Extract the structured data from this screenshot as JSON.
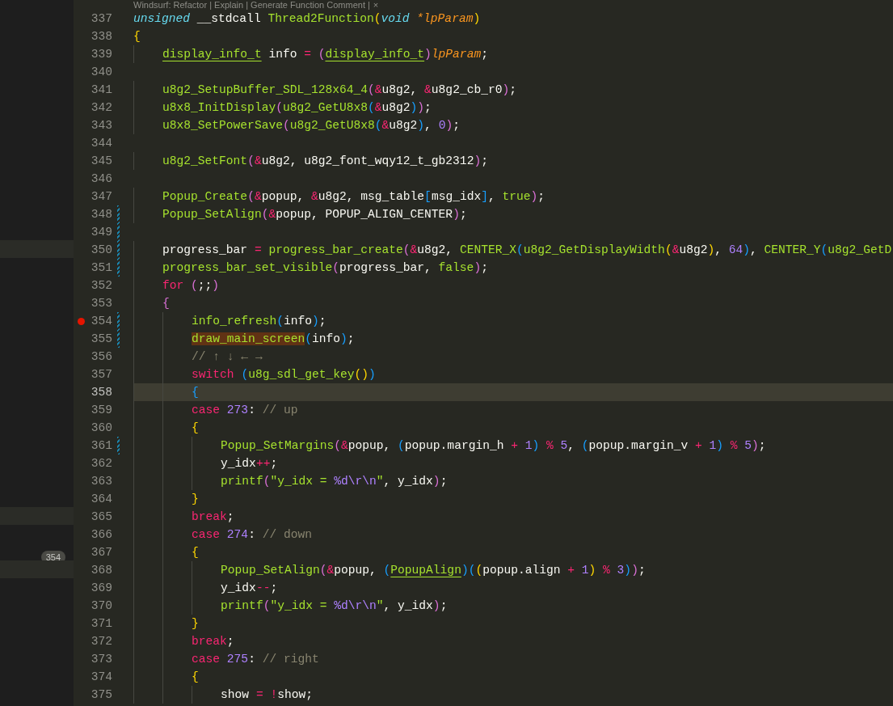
{
  "codelens": {
    "text": "Windsurf: Refactor | Explain | Generate Function Comment |",
    "close": "×"
  },
  "side_panel": {
    "rows": [
      {
        "kind": "blank"
      },
      {
        "kind": "blank"
      },
      {
        "kind": "blank"
      },
      {
        "kind": "blank"
      },
      {
        "kind": "blank"
      },
      {
        "kind": "blank"
      },
      {
        "kind": "blank"
      },
      {
        "kind": "blank"
      },
      {
        "kind": "blank"
      },
      {
        "kind": "blank"
      },
      {
        "kind": "blank"
      },
      {
        "kind": "blank"
      },
      {
        "kind": "blank"
      },
      {
        "kind": "band"
      },
      {
        "kind": "blank"
      },
      {
        "kind": "blank"
      },
      {
        "kind": "blank"
      },
      {
        "kind": "blank"
      },
      {
        "kind": "blank"
      },
      {
        "kind": "blank"
      },
      {
        "kind": "blank"
      },
      {
        "kind": "blank"
      },
      {
        "kind": "blank"
      },
      {
        "kind": "blank"
      },
      {
        "kind": "blank"
      },
      {
        "kind": "blank"
      },
      {
        "kind": "blank"
      },
      {
        "kind": "blank"
      },
      {
        "kind": "band"
      },
      {
        "kind": "blank"
      },
      {
        "kind": "blank",
        "badge": "354"
      },
      {
        "kind": "band"
      },
      {
        "kind": "blank"
      },
      {
        "kind": "blank"
      },
      {
        "kind": "blank"
      },
      {
        "kind": "blank"
      },
      {
        "kind": "blank"
      },
      {
        "kind": "blank"
      },
      {
        "kind": "blank"
      }
    ]
  },
  "lines": [
    {
      "number": "337",
      "current": false,
      "breakpoint": false,
      "modified": false,
      "tokens": [
        {
          "kind": "type",
          "text": "unsigned"
        },
        {
          "kind": "plain",
          "text": " __stdcall "
        },
        {
          "kind": "fn",
          "text": "Thread2Function"
        },
        {
          "kind": "bracket1",
          "text": "("
        },
        {
          "kind": "type",
          "text": "void "
        },
        {
          "kind": "param",
          "text": "*lpParam"
        },
        {
          "kind": "bracket1",
          "text": ")"
        }
      ]
    },
    {
      "number": "338",
      "current": false,
      "breakpoint": false,
      "modified": false,
      "tokens": [
        {
          "kind": "bracket1",
          "text": "{"
        }
      ]
    },
    {
      "number": "339",
      "current": false,
      "breakpoint": false,
      "modified": false,
      "tokens": [
        {
          "kind": "typeref",
          "text": "    display_info_t"
        },
        {
          "kind": "plain",
          "text": " info "
        },
        {
          "kind": "op",
          "text": "= "
        },
        {
          "kind": "bracket2",
          "text": "("
        },
        {
          "kind": "typeref",
          "text": "display_info_t"
        },
        {
          "kind": "bracket2",
          "text": ")"
        },
        {
          "kind": "param",
          "text": "lpParam"
        },
        {
          "kind": "plain",
          "text": ";"
        }
      ]
    },
    {
      "number": "340",
      "current": false,
      "breakpoint": false,
      "modified": false
    },
    {
      "number": "341",
      "current": false,
      "breakpoint": false,
      "modified": false,
      "tokens": [
        {
          "kind": "fn",
          "text": "    u8g2_SetupBuffer_SDL_128x64_4"
        },
        {
          "kind": "bracket2",
          "text": "("
        },
        {
          "kind": "op",
          "text": "&"
        },
        {
          "kind": "plain",
          "text": "u8g2, "
        },
        {
          "kind": "op",
          "text": "&"
        },
        {
          "kind": "plain",
          "text": "u8g2_cb_r0"
        },
        {
          "kind": "bracket2",
          "text": ")"
        },
        {
          "kind": "plain",
          "text": ";"
        }
      ]
    },
    {
      "number": "342",
      "current": false,
      "breakpoint": false,
      "modified": false,
      "tokens": [
        {
          "kind": "fn",
          "text": "    u8x8_InitDisplay"
        },
        {
          "kind": "bracket2",
          "text": "("
        },
        {
          "kind": "fn",
          "text": "u8g2_GetU8x8"
        },
        {
          "kind": "bracket3",
          "text": "("
        },
        {
          "kind": "op",
          "text": "&"
        },
        {
          "kind": "plain",
          "text": "u8g2"
        },
        {
          "kind": "bracket3",
          "text": ")"
        },
        {
          "kind": "bracket2",
          "text": ")"
        },
        {
          "kind": "plain",
          "text": ";"
        }
      ]
    },
    {
      "number": "343",
      "current": false,
      "breakpoint": false,
      "modified": false,
      "tokens": [
        {
          "kind": "fn",
          "text": "    u8x8_SetPowerSave"
        },
        {
          "kind": "bracket2",
          "text": "("
        },
        {
          "kind": "fn",
          "text": "u8g2_GetU8x8"
        },
        {
          "kind": "bracket3",
          "text": "("
        },
        {
          "kind": "op",
          "text": "&"
        },
        {
          "kind": "plain",
          "text": "u8g2"
        },
        {
          "kind": "bracket3",
          "text": ")"
        },
        {
          "kind": "plain",
          "text": ", "
        },
        {
          "kind": "num",
          "text": "0"
        },
        {
          "kind": "bracket2",
          "text": ")"
        },
        {
          "kind": "plain",
          "text": ";"
        }
      ]
    },
    {
      "number": "344",
      "current": false,
      "breakpoint": false,
      "modified": false
    },
    {
      "number": "345",
      "current": false,
      "breakpoint": false,
      "modified": false,
      "tokens": [
        {
          "kind": "fn",
          "text": "    u8g2_SetFont"
        },
        {
          "kind": "bracket2",
          "text": "("
        },
        {
          "kind": "op",
          "text": "&"
        },
        {
          "kind": "plain",
          "text": "u8g2, u8g2_font_wqy12_t_gb2312"
        },
        {
          "kind": "bracket2",
          "text": ")"
        },
        {
          "kind": "plain",
          "text": ";"
        }
      ]
    },
    {
      "number": "346",
      "current": false,
      "breakpoint": false,
      "modified": false
    },
    {
      "number": "347",
      "current": false,
      "breakpoint": false,
      "modified": false,
      "tokens": [
        {
          "kind": "fn",
          "text": "    Popup_Create"
        },
        {
          "kind": "bracket2",
          "text": "("
        },
        {
          "kind": "op",
          "text": "&"
        },
        {
          "kind": "plain",
          "text": "popup, "
        },
        {
          "kind": "op",
          "text": "&"
        },
        {
          "kind": "plain",
          "text": "u8g2, msg_table"
        },
        {
          "kind": "bracket3",
          "text": "["
        },
        {
          "kind": "plain",
          "text": "msg_idx"
        },
        {
          "kind": "bracket3",
          "text": "]"
        },
        {
          "kind": "plain",
          "text": ", "
        },
        {
          "kind": "fn",
          "text": "true"
        },
        {
          "kind": "bracket2",
          "text": ")"
        },
        {
          "kind": "plain",
          "text": ";"
        }
      ]
    },
    {
      "number": "348",
      "current": false,
      "breakpoint": false,
      "modified": true,
      "tokens": [
        {
          "kind": "fn",
          "text": "    Popup_SetAlign"
        },
        {
          "kind": "bracket2",
          "text": "("
        },
        {
          "kind": "op",
          "text": "&"
        },
        {
          "kind": "plain",
          "text": "popup, POPUP_ALIGN_CENTER"
        },
        {
          "kind": "bracket2",
          "text": ")"
        },
        {
          "kind": "plain",
          "text": ";"
        }
      ]
    },
    {
      "number": "349",
      "current": false,
      "breakpoint": false,
      "modified": true
    },
    {
      "number": "350",
      "current": false,
      "breakpoint": false,
      "modified": true,
      "tokens": [
        {
          "kind": "plain",
          "text": "    progress_bar "
        },
        {
          "kind": "op",
          "text": "= "
        },
        {
          "kind": "fn",
          "text": "progress_bar_create"
        },
        {
          "kind": "bracket2",
          "text": "("
        },
        {
          "kind": "op",
          "text": "&"
        },
        {
          "kind": "plain",
          "text": "u8g2, "
        },
        {
          "kind": "fn",
          "text": "CENTER_X"
        },
        {
          "kind": "bracket3",
          "text": "("
        },
        {
          "kind": "fn",
          "text": "u8g2_GetDisplayWidth"
        },
        {
          "kind": "bracket1",
          "text": "("
        },
        {
          "kind": "op",
          "text": "&"
        },
        {
          "kind": "plain",
          "text": "u8g2"
        },
        {
          "kind": "bracket1",
          "text": ")"
        },
        {
          "kind": "plain",
          "text": ", "
        },
        {
          "kind": "num",
          "text": "64"
        },
        {
          "kind": "bracket3",
          "text": ")"
        },
        {
          "kind": "plain",
          "text": ", "
        },
        {
          "kind": "fn",
          "text": "CENTER_Y"
        },
        {
          "kind": "bracket3",
          "text": "("
        },
        {
          "kind": "fn",
          "text": "u8g2_GetD"
        }
      ]
    },
    {
      "number": "351",
      "current": false,
      "breakpoint": false,
      "modified": true,
      "tokens": [
        {
          "kind": "fn",
          "text": "    progress_bar_set_visible"
        },
        {
          "kind": "bracket2",
          "text": "("
        },
        {
          "kind": "plain",
          "text": "progress_bar, "
        },
        {
          "kind": "fn",
          "text": "false"
        },
        {
          "kind": "bracket2",
          "text": ")"
        },
        {
          "kind": "plain",
          "text": ";"
        }
      ]
    },
    {
      "number": "352",
      "current": false,
      "breakpoint": false,
      "modified": false,
      "tokens": [
        {
          "kind": "kw",
          "text": "    for "
        },
        {
          "kind": "bracket2",
          "text": "("
        },
        {
          "kind": "plain",
          "text": ";;"
        },
        {
          "kind": "bracket2",
          "text": ")"
        }
      ]
    },
    {
      "number": "353",
      "current": false,
      "breakpoint": false,
      "modified": false,
      "tokens": [
        {
          "kind": "bracket2",
          "text": "    {"
        }
      ]
    },
    {
      "number": "354",
      "current": false,
      "breakpoint": true,
      "modified": true,
      "tokens": [
        {
          "kind": "fn",
          "text": "        info_refresh"
        },
        {
          "kind": "bracket3",
          "text": "("
        },
        {
          "kind": "plain",
          "text": "info"
        },
        {
          "kind": "bracket3",
          "text": ")"
        },
        {
          "kind": "plain",
          "text": ";"
        }
      ]
    },
    {
      "number": "355",
      "current": false,
      "breakpoint": false,
      "modified": true,
      "tokens": [
        {
          "kind": "match",
          "text": "        draw_main_screen"
        },
        {
          "kind": "bracket3",
          "text": "("
        },
        {
          "kind": "plain",
          "text": "info"
        },
        {
          "kind": "bracket3",
          "text": ")"
        },
        {
          "kind": "plain",
          "text": ";"
        }
      ]
    },
    {
      "number": "356",
      "current": false,
      "breakpoint": false,
      "modified": false,
      "tokens": [
        {
          "kind": "comment",
          "text": "        // ↑ ↓ ← →"
        }
      ]
    },
    {
      "number": "357",
      "current": false,
      "breakpoint": false,
      "modified": false,
      "tokens": [
        {
          "kind": "kw",
          "text": "        switch "
        },
        {
          "kind": "bracket3",
          "text": "("
        },
        {
          "kind": "fn",
          "text": "u8g_sdl_get_key"
        },
        {
          "kind": "bracket1",
          "text": "()"
        },
        {
          "kind": "bracket3",
          "text": ")"
        }
      ]
    },
    {
      "number": "358",
      "current": true,
      "breakpoint": false,
      "modified": false,
      "tokens": [
        {
          "kind": "bracket3",
          "text": "        {"
        }
      ]
    },
    {
      "number": "359",
      "current": false,
      "breakpoint": false,
      "modified": false,
      "tokens": [
        {
          "kind": "kw",
          "text": "        case "
        },
        {
          "kind": "num",
          "text": "273"
        },
        {
          "kind": "plain",
          "text": ": "
        },
        {
          "kind": "comment",
          "text": "// up"
        }
      ]
    },
    {
      "number": "360",
      "current": false,
      "breakpoint": false,
      "modified": false,
      "tokens": [
        {
          "kind": "bracket1",
          "text": "        {"
        }
      ]
    },
    {
      "number": "361",
      "current": false,
      "breakpoint": false,
      "modified": true,
      "tokens": [
        {
          "kind": "fn",
          "text": "            Popup_SetMargins"
        },
        {
          "kind": "bracket2",
          "text": "("
        },
        {
          "kind": "op",
          "text": "&"
        },
        {
          "kind": "plain",
          "text": "popup, "
        },
        {
          "kind": "bracket3",
          "text": "("
        },
        {
          "kind": "plain",
          "text": "popup.margin_h "
        },
        {
          "kind": "op",
          "text": "+ "
        },
        {
          "kind": "num",
          "text": "1"
        },
        {
          "kind": "bracket3",
          "text": ")"
        },
        {
          "kind": "op",
          "text": " % "
        },
        {
          "kind": "num",
          "text": "5"
        },
        {
          "kind": "plain",
          "text": ", "
        },
        {
          "kind": "bracket3",
          "text": "("
        },
        {
          "kind": "plain",
          "text": "popup.margin_v "
        },
        {
          "kind": "op",
          "text": "+ "
        },
        {
          "kind": "num",
          "text": "1"
        },
        {
          "kind": "bracket3",
          "text": ")"
        },
        {
          "kind": "op",
          "text": " % "
        },
        {
          "kind": "num",
          "text": "5"
        },
        {
          "kind": "bracket2",
          "text": ")"
        },
        {
          "kind": "plain",
          "text": ";"
        }
      ]
    },
    {
      "number": "362",
      "current": false,
      "breakpoint": false,
      "modified": false,
      "tokens": [
        {
          "kind": "plain",
          "text": "            y_idx"
        },
        {
          "kind": "op",
          "text": "++"
        },
        {
          "kind": "plain",
          "text": ";"
        }
      ]
    },
    {
      "number": "363",
      "current": false,
      "breakpoint": false,
      "modified": false,
      "tokens": [
        {
          "kind": "fn",
          "text": "            printf"
        },
        {
          "kind": "bracket2",
          "text": "("
        },
        {
          "kind": "str",
          "text": "\"y_idx = "
        },
        {
          "kind": "num",
          "text": "%d\\r\\n"
        },
        {
          "kind": "str",
          "text": "\""
        },
        {
          "kind": "plain",
          "text": ", y_idx"
        },
        {
          "kind": "bracket2",
          "text": ")"
        },
        {
          "kind": "plain",
          "text": ";"
        }
      ]
    },
    {
      "number": "364",
      "current": false,
      "breakpoint": false,
      "modified": false,
      "tokens": [
        {
          "kind": "bracket1",
          "text": "        }"
        }
      ]
    },
    {
      "number": "365",
      "current": false,
      "breakpoint": false,
      "modified": false,
      "tokens": [
        {
          "kind": "kw",
          "text": "        break"
        },
        {
          "kind": "plain",
          "text": ";"
        }
      ]
    },
    {
      "number": "366",
      "current": false,
      "breakpoint": false,
      "modified": false,
      "tokens": [
        {
          "kind": "kw",
          "text": "        case "
        },
        {
          "kind": "num",
          "text": "274"
        },
        {
          "kind": "plain",
          "text": ": "
        },
        {
          "kind": "comment",
          "text": "// down"
        }
      ]
    },
    {
      "number": "367",
      "current": false,
      "breakpoint": false,
      "modified": false,
      "tokens": [
        {
          "kind": "bracket1",
          "text": "        {"
        }
      ]
    },
    {
      "number": "368",
      "current": false,
      "breakpoint": false,
      "modified": false,
      "tokens": [
        {
          "kind": "fn",
          "text": "            Popup_SetAlign"
        },
        {
          "kind": "bracket2",
          "text": "("
        },
        {
          "kind": "op",
          "text": "&"
        },
        {
          "kind": "plain",
          "text": "popup, "
        },
        {
          "kind": "bracket3",
          "text": "("
        },
        {
          "kind": "typeref",
          "text": "PopupAlign"
        },
        {
          "kind": "bracket3",
          "text": ")("
        },
        {
          "kind": "bracket1",
          "text": "("
        },
        {
          "kind": "plain",
          "text": "popup.align "
        },
        {
          "kind": "op",
          "text": "+ "
        },
        {
          "kind": "num",
          "text": "1"
        },
        {
          "kind": "bracket1",
          "text": ")"
        },
        {
          "kind": "op",
          "text": " % "
        },
        {
          "kind": "num",
          "text": "3"
        },
        {
          "kind": "bracket3",
          "text": ")"
        },
        {
          "kind": "bracket2",
          "text": ")"
        },
        {
          "kind": "plain",
          "text": ";"
        }
      ]
    },
    {
      "number": "369",
      "current": false,
      "breakpoint": false,
      "modified": false,
      "tokens": [
        {
          "kind": "plain",
          "text": "            y_idx"
        },
        {
          "kind": "op",
          "text": "--"
        },
        {
          "kind": "plain",
          "text": ";"
        }
      ]
    },
    {
      "number": "370",
      "current": false,
      "breakpoint": false,
      "modified": false,
      "tokens": [
        {
          "kind": "fn",
          "text": "            printf"
        },
        {
          "kind": "bracket2",
          "text": "("
        },
        {
          "kind": "str",
          "text": "\"y_idx = "
        },
        {
          "kind": "num",
          "text": "%d\\r\\n"
        },
        {
          "kind": "str",
          "text": "\""
        },
        {
          "kind": "plain",
          "text": ", y_idx"
        },
        {
          "kind": "bracket2",
          "text": ")"
        },
        {
          "kind": "plain",
          "text": ";"
        }
      ]
    },
    {
      "number": "371",
      "current": false,
      "breakpoint": false,
      "modified": false,
      "tokens": [
        {
          "kind": "bracket1",
          "text": "        }"
        }
      ]
    },
    {
      "number": "372",
      "current": false,
      "breakpoint": false,
      "modified": false,
      "tokens": [
        {
          "kind": "kw",
          "text": "        break"
        },
        {
          "kind": "plain",
          "text": ";"
        }
      ]
    },
    {
      "number": "373",
      "current": false,
      "breakpoint": false,
      "modified": false,
      "tokens": [
        {
          "kind": "kw",
          "text": "        case "
        },
        {
          "kind": "num",
          "text": "275"
        },
        {
          "kind": "plain",
          "text": ": "
        },
        {
          "kind": "comment",
          "text": "// right"
        }
      ]
    },
    {
      "number": "374",
      "current": false,
      "breakpoint": false,
      "modified": false,
      "tokens": [
        {
          "kind": "bracket1",
          "text": "        {"
        }
      ]
    },
    {
      "number": "375",
      "current": false,
      "breakpoint": false,
      "modified": false,
      "tokens": [
        {
          "kind": "plain",
          "text": "            show "
        },
        {
          "kind": "op",
          "text": "= !"
        },
        {
          "kind": "plain",
          "text": "show;"
        }
      ]
    }
  ]
}
